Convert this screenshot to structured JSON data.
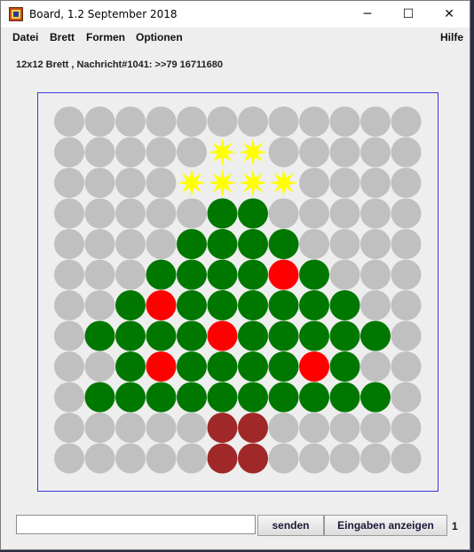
{
  "window": {
    "title": "Board, 1.2 September 2018",
    "controls": {
      "minimize": "─",
      "maximize": "☐",
      "close": "✕"
    }
  },
  "menu": {
    "items": [
      "Datei",
      "Brett",
      "Formen",
      "Optionen"
    ],
    "help": "Hilfe"
  },
  "status": {
    "text": "12x12 Brett , Nachricht#1041: >>79 16711680"
  },
  "board": {
    "rows": 12,
    "cols": 12,
    "colors": {
      "E": "#c0c0c0",
      "G": "#007800",
      "R": "#ff0000",
      "D": "#a02828",
      "Y": "#ffff00"
    },
    "cells": [
      "EEEEEEEEEEEE",
      "EEEEEYYEEEEE",
      "EEEEYYYYEEEE",
      "EEEEEGGEEEEE",
      "EEEEGGGGEEEE",
      "EEEGGGGRGEEE",
      "EEGRGGGGGGEE",
      "EGGGGRGGGGGE",
      "EEGRGGGGRGEE",
      "EGGGGGGGGGGE",
      "EEEEEDDEEEEE",
      "EEEEEDDEEEEE"
    ]
  },
  "input": {
    "value": "",
    "placeholder": ""
  },
  "buttons": {
    "send": "senden",
    "show_inputs": "Eingaben anzeigen"
  },
  "counter": "1"
}
